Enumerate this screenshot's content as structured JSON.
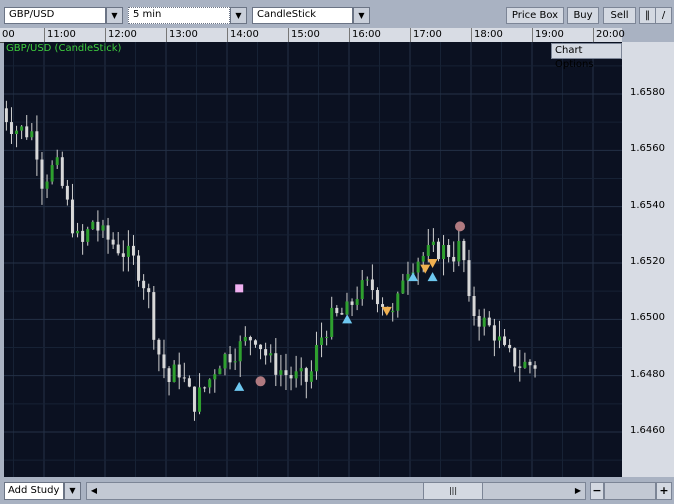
{
  "toolbar": {
    "symbol": "GBP/USD",
    "interval": "5 min",
    "chart_type": "CandleStick",
    "price_box": "Price Box",
    "buy": "Buy",
    "sell": "Sell",
    "icons": [
      "bars-icon",
      "line-draw-icon"
    ]
  },
  "chart_title": "GBP/USD (CandleStick)",
  "chart_options": "Chart Options",
  "bottom": {
    "add_study": "Add Study",
    "zoom_out": "−",
    "zoom_in": "+"
  },
  "chart_data": {
    "type": "candlestick",
    "title": "GBP/USD (CandleStick)",
    "x_ticks": [
      "00",
      "11:00",
      "12:00",
      "13:00",
      "14:00",
      "15:00",
      "16:00",
      "17:00",
      "18:00",
      "19:00",
      "20:00"
    ],
    "y_ticks": [
      "1.6580",
      "1.6560",
      "1.6540",
      "1.6520",
      "1.6500",
      "1.6480",
      "1.6460"
    ],
    "ylim": [
      1.6452,
      1.6605
    ],
    "candle_minutes": 5,
    "price_path": [
      [
        10.3,
        1.6575
      ],
      [
        10.5,
        1.6568
      ],
      [
        10.85,
        1.6566
      ],
      [
        10.95,
        1.6549
      ],
      [
        11.2,
        1.6555
      ],
      [
        11.45,
        1.6535
      ],
      [
        11.6,
        1.6525
      ],
      [
        11.8,
        1.6535
      ],
      [
        11.95,
        1.653
      ],
      [
        12.25,
        1.6525
      ],
      [
        12.5,
        1.652
      ],
      [
        12.7,
        1.651
      ],
      [
        12.85,
        1.649
      ],
      [
        13.05,
        1.6478
      ],
      [
        13.2,
        1.6483
      ],
      [
        13.45,
        1.647
      ],
      [
        13.7,
        1.6478
      ],
      [
        13.85,
        1.6485
      ],
      [
        14.2,
        1.649
      ],
      [
        14.45,
        1.6495
      ],
      [
        14.7,
        1.6485
      ],
      [
        15.0,
        1.648
      ],
      [
        15.35,
        1.6478
      ],
      [
        15.5,
        1.6492
      ],
      [
        15.7,
        1.65
      ],
      [
        15.95,
        1.6502
      ],
      [
        16.15,
        1.651
      ],
      [
        16.35,
        1.6512
      ],
      [
        16.6,
        1.6505
      ],
      [
        16.75,
        1.65
      ],
      [
        16.9,
        1.6518
      ],
      [
        17.15,
        1.6522
      ],
      [
        17.5,
        1.6525
      ],
      [
        17.75,
        1.6523
      ],
      [
        17.85,
        1.6528
      ],
      [
        17.95,
        1.6505
      ],
      [
        18.15,
        1.65
      ],
      [
        18.4,
        1.6495
      ],
      [
        18.55,
        1.6488
      ],
      [
        18.8,
        1.6484
      ],
      [
        19.05,
        1.6484
      ]
    ],
    "markers": [
      {
        "shape": "square",
        "color": "#f0b0f0",
        "time": 14.2,
        "price": 1.6511
      },
      {
        "shape": "circle",
        "color": "#b07a80",
        "time": 14.55,
        "price": 1.6478
      },
      {
        "shape": "circle",
        "color": "#b07a80",
        "time": 17.82,
        "price": 1.6533
      },
      {
        "shape": "up",
        "color": "#6ec8f0",
        "time": 14.2,
        "price": 1.6476
      },
      {
        "shape": "up",
        "color": "#6ec8f0",
        "time": 15.97,
        "price": 1.65
      },
      {
        "shape": "up",
        "color": "#6ec8f0",
        "time": 17.05,
        "price": 1.6515
      },
      {
        "shape": "up",
        "color": "#6ec8f0",
        "time": 17.37,
        "price": 1.6515
      },
      {
        "shape": "down",
        "color": "#f0b050",
        "time": 16.62,
        "price": 1.6503
      },
      {
        "shape": "down",
        "color": "#f0b050",
        "time": 17.25,
        "price": 1.6518
      },
      {
        "shape": "down",
        "color": "#f0b050",
        "time": 17.37,
        "price": 1.652
      }
    ]
  }
}
